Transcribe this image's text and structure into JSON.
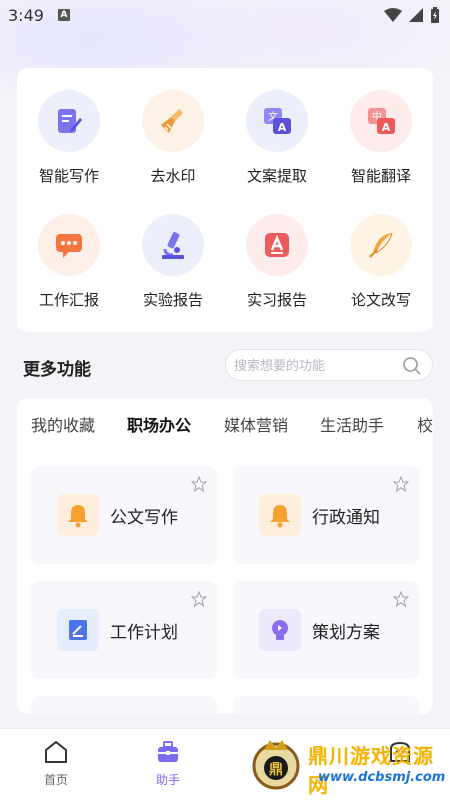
{
  "status_bar": {
    "time": "3:49",
    "a_badge": "A"
  },
  "tools": [
    {
      "label": "智能写作",
      "icon": "pen-doc-icon",
      "bg": "#eceef9",
      "color": "#6b62e8"
    },
    {
      "label": "去水印",
      "icon": "broom-icon",
      "bg": "#fdf2e6",
      "color": "#f29a3a"
    },
    {
      "label": "文案提取",
      "icon": "translate-doc-icon",
      "bg": "#eceef9",
      "color": "#6b62e8"
    },
    {
      "label": "智能翻译",
      "icon": "translate-icon",
      "bg": "#fdeceb",
      "color": "#f06a6a"
    },
    {
      "label": "工作汇报",
      "icon": "chat-report-icon",
      "bg": "#fdefe8",
      "color": "#f5763f"
    },
    {
      "label": "实验报告",
      "icon": "microscope-icon",
      "bg": "#eceef9",
      "color": "#6b62e8"
    },
    {
      "label": "实习报告",
      "icon": "letter-a-icon",
      "bg": "#fdeceb",
      "color": "#f06a6a"
    },
    {
      "label": "论文改写",
      "icon": "feather-icon",
      "bg": "#fdf4e6",
      "color": "#f3a33a"
    }
  ],
  "more": {
    "title": "更多功能",
    "search_placeholder": "搜索想要的功能"
  },
  "tabs": [
    "我的收藏",
    "职场办公",
    "媒体营销",
    "生活助手",
    "校"
  ],
  "active_tab": "职场办公",
  "functions": [
    {
      "label": "公文写作",
      "icon": "bell-icon",
      "bg": "#fdeedd",
      "color": "#f5a030"
    },
    {
      "label": "行政通知",
      "icon": "bell-icon",
      "bg": "#fdeedd",
      "color": "#f5a030"
    },
    {
      "label": "工作计划",
      "icon": "plan-icon",
      "bg": "#e5ecfb",
      "color": "#4c74e6"
    },
    {
      "label": "策划方案",
      "icon": "bulb-icon",
      "bg": "#ede8fb",
      "color": "#8b6cf0"
    }
  ],
  "nav": {
    "home": "首页",
    "assistant": "助手"
  },
  "watermark": {
    "name": "鼎川游戏资源网",
    "url": "www.dcbsmj.com"
  },
  "colors": {
    "accent": "#7a6bf0"
  }
}
